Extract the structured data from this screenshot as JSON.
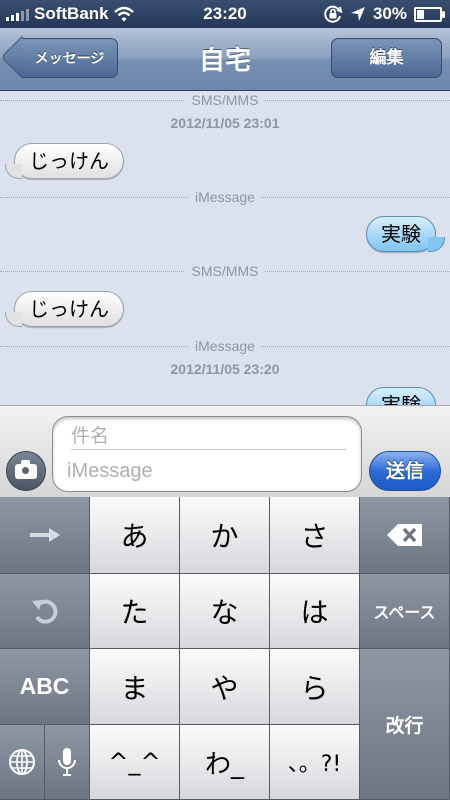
{
  "status_bar": {
    "carrier": "SoftBank",
    "time": "23:20",
    "battery": "30%",
    "battery_level": 0.3,
    "icons": [
      "signal-icon",
      "wifi-icon",
      "orientation-lock-icon",
      "location-arrow-icon",
      "battery-icon"
    ]
  },
  "nav": {
    "back_label": "メッセージ",
    "title": "自宅",
    "edit_label": "編集"
  },
  "conversation": {
    "sms_header_1": "SMS/MMS",
    "date_1": "2012/11/05 23:01",
    "incoming_1": "じっけん",
    "imessage_header_1": "iMessage",
    "outgoing_1": "実験",
    "sms_header_2": "SMS/MMS",
    "incoming_2": "じっけん",
    "imessage_header_2": "iMessage",
    "date_2": "2012/11/05 23:20",
    "outgoing_2": "実験"
  },
  "compose": {
    "subject_placeholder": "件名",
    "message_placeholder": "iMessage",
    "send_label": "送信",
    "camera_icon": "camera-icon"
  },
  "keyboard": {
    "next_candidate_icon": "right-arrow-icon",
    "undo_icon": "undo-icon",
    "globe_icon": "globe-icon",
    "mic_icon": "microphone-icon",
    "delete_icon": "backspace-icon",
    "key_a": "あ",
    "key_ka": "か",
    "key_sa": "さ",
    "key_ta": "た",
    "key_na": "な",
    "key_ha": "は",
    "key_ma": "ま",
    "key_ya": "や",
    "key_ra": "ら",
    "key_emoticon": "^_^",
    "key_wa": "わ_",
    "key_punct": "、。?!",
    "abc_label": "ABC",
    "space_label": "スペース",
    "return_label": "改行"
  }
}
